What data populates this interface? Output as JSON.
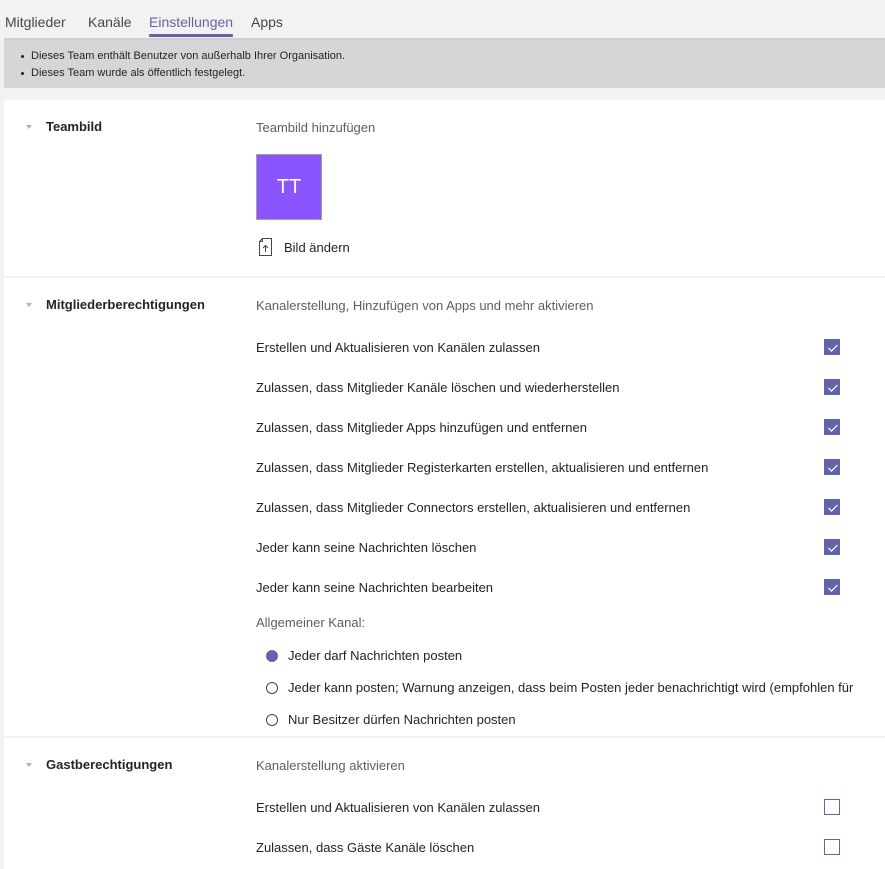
{
  "tabs": [
    {
      "label": "Mitglieder",
      "active": false
    },
    {
      "label": "Kanäle",
      "active": false
    },
    {
      "label": "Einstellungen",
      "active": true
    },
    {
      "label": "Apps",
      "active": false
    }
  ],
  "banner": {
    "items": [
      "Dieses Team enthält Benutzer von außerhalb Ihrer Organisation.",
      "Dieses Team wurde als öffentlich festgelegt."
    ]
  },
  "teambild": {
    "title": "Teambild",
    "subtitle": "Teambild hinzufügen",
    "avatar_initials": "TT",
    "avatar_color": "#8a54ff",
    "change_label": "Bild ändern",
    "change_icon": "upload-file-icon"
  },
  "mitglieder": {
    "title": "Mitgliederberechtigungen",
    "subtitle": "Kanalerstellung, Hinzufügen von Apps und mehr aktivieren",
    "options": [
      {
        "label": "Erstellen und Aktualisieren von Kanälen zulassen",
        "checked": true
      },
      {
        "label": "Zulassen, dass Mitglieder Kanäle löschen und wiederherstellen",
        "checked": true
      },
      {
        "label": "Zulassen, dass Mitglieder Apps hinzufügen und entfernen",
        "checked": true
      },
      {
        "label": "Zulassen, dass Mitglieder Registerkarten erstellen, aktualisieren und entfernen",
        "checked": true
      },
      {
        "label": "Zulassen, dass Mitglieder Connectors erstellen, aktualisieren und entfernen",
        "checked": true
      },
      {
        "label": "Jeder kann seine Nachrichten löschen",
        "checked": true
      },
      {
        "label": "Jeder kann seine Nachrichten bearbeiten",
        "checked": true
      }
    ],
    "general_channel_label": "Allgemeiner Kanal:",
    "radios": [
      {
        "label": "Jeder darf Nachrichten posten",
        "selected": true
      },
      {
        "label": "Jeder kann posten; Warnung anzeigen, dass beim Posten jeder benachrichtigt wird (empfohlen für",
        "selected": false
      },
      {
        "label": "Nur Besitzer dürfen Nachrichten posten",
        "selected": false
      }
    ]
  },
  "gast": {
    "title": "Gastberechtigungen",
    "subtitle": "Kanalerstellung aktivieren",
    "options": [
      {
        "label": "Erstellen und Aktualisieren von Kanälen zulassen",
        "checked": false
      },
      {
        "label": "Zulassen, dass Gäste Kanäle löschen",
        "checked": false
      }
    ]
  },
  "colors": {
    "accent": "#6264a7",
    "banner_bg": "#d6d6d6",
    "page_bg": "#f3f2f1"
  }
}
